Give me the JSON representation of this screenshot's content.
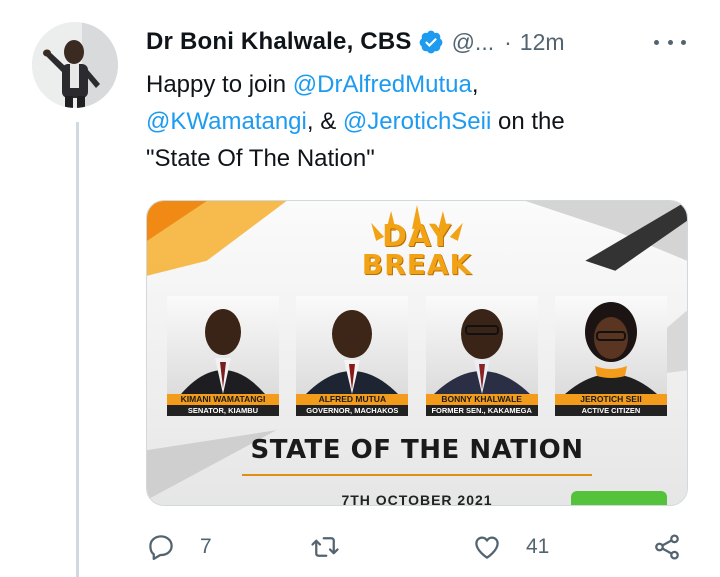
{
  "tweet": {
    "author_name": "Dr Boni Khalwale, CBS",
    "handle": "@...",
    "separator": "·",
    "time": "12m",
    "text_parts": {
      "lead": "Happy to join ",
      "mention1": "@DrAlfredMutua",
      "comma": ",",
      "mention2": "@KWamatangi",
      "amp": ", & ",
      "mention3": "@JerotichSeii",
      "tail": " on the",
      "line3": "\"State Of The Nation\""
    },
    "verified": true,
    "more_icon": "more-dots-icon"
  },
  "media": {
    "daybreak_top": "DAY",
    "daybreak_bottom": "BREAK",
    "guests": [
      {
        "name": "KIMANI WAMATANGI",
        "role": "SENATOR, KIAMBU"
      },
      {
        "name": "ALFRED MUTUA",
        "role": "GOVERNOR, MACHAKOS"
      },
      {
        "name": "BONNY KHALWALE",
        "role": "FORMER SEN., KAKAMEGA"
      },
      {
        "name": "JEROTICH SEII",
        "role": "ACTIVE CITIZEN"
      }
    ],
    "headline": "STATE OF THE NATION",
    "date": "7TH OCTOBER 2021",
    "colors": {
      "accent": "#f39b1a",
      "dark": "#222222"
    }
  },
  "actions": {
    "reply_count": "7",
    "retweet_count": "",
    "like_count": "41",
    "icons": [
      "reply-icon",
      "retweet-icon",
      "like-icon",
      "share-icon"
    ]
  },
  "colors": {
    "link": "#1d9bf0",
    "secondary": "#536471",
    "thread": "#cfd9de"
  }
}
